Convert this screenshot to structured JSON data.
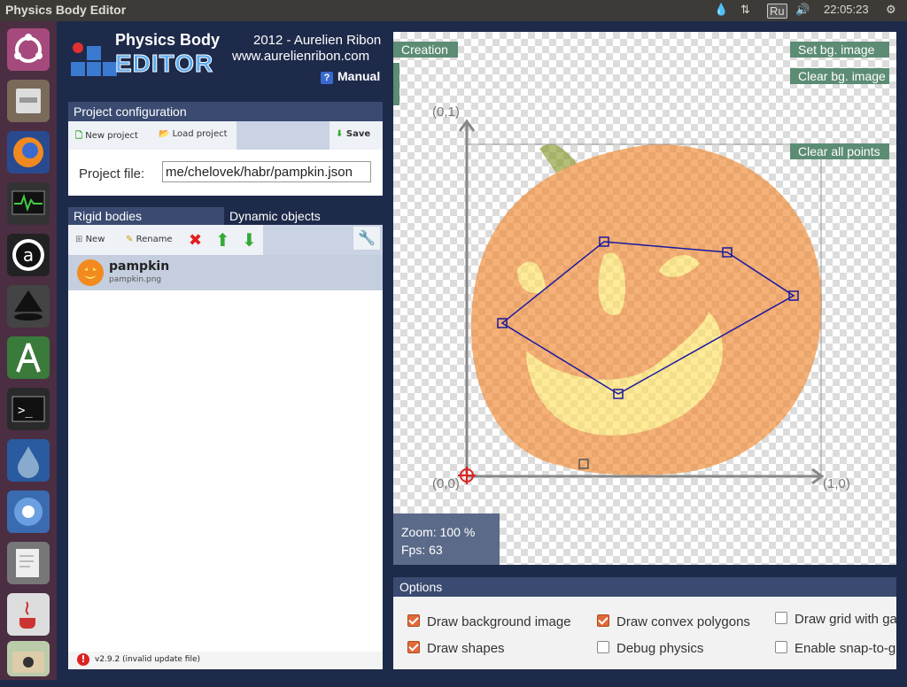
{
  "window": {
    "title": "Physics Body Editor"
  },
  "tray": {
    "lang": "Ru",
    "time": "22:05:23"
  },
  "launcher": {
    "items": [
      "ubuntu-icon",
      "files-icon",
      "firefox-icon",
      "system-monitor-icon",
      "a-icon",
      "inkscape-icon",
      "android-studio-icon",
      "terminal-icon",
      "deluge-icon",
      "chromium-icon",
      "text-editor-icon",
      "java-icon",
      "storage-icon"
    ]
  },
  "header": {
    "logo_line1": "Physics Body",
    "logo_line2": "EDITOR",
    "credit": "2012 - Aurelien Ribon",
    "site": "www.aurelienribon.com",
    "manual": "Manual"
  },
  "project": {
    "section_title": "Project configuration",
    "new_project": "New project",
    "load_project": "Load project",
    "save": "Save",
    "file_label": "Project file:",
    "file_value": "me/chelovek/habr/pampkin.json"
  },
  "bodies": {
    "tab_rigid": "Rigid bodies",
    "tab_dynamic": "Dynamic objects",
    "new": "New",
    "rename": "Rename",
    "items": [
      {
        "name": "pampkin",
        "file": "pampkin.png"
      }
    ]
  },
  "status": {
    "version": "v2.9.2 (invalid update file)"
  },
  "canvas": {
    "mode": "Creation",
    "set_bg": "Set bg. image",
    "clear_bg": "Clear bg. image",
    "clear_points": "Clear all points",
    "axis_origin": "(0,0)",
    "axis_y": "(0,1)",
    "axis_x": "(1,0)",
    "zoom": "Zoom: 100 %",
    "fps": "Fps: 63"
  },
  "options": {
    "title": "Options",
    "draw_bg": {
      "label": "Draw background image",
      "checked": true
    },
    "draw_convex": {
      "label": "Draw convex polygons",
      "checked": true
    },
    "draw_grid": {
      "label": "Draw grid with ga",
      "checked": false
    },
    "draw_shapes": {
      "label": "Draw shapes",
      "checked": true
    },
    "debug_physics": {
      "label": "Debug physics",
      "checked": false
    },
    "snap": {
      "label": "Enable snap-to-g",
      "checked": false
    }
  },
  "colors": {
    "accent": "#3a4a70",
    "button_green": "#5c8c74",
    "polygon": "#1a1aa0"
  }
}
